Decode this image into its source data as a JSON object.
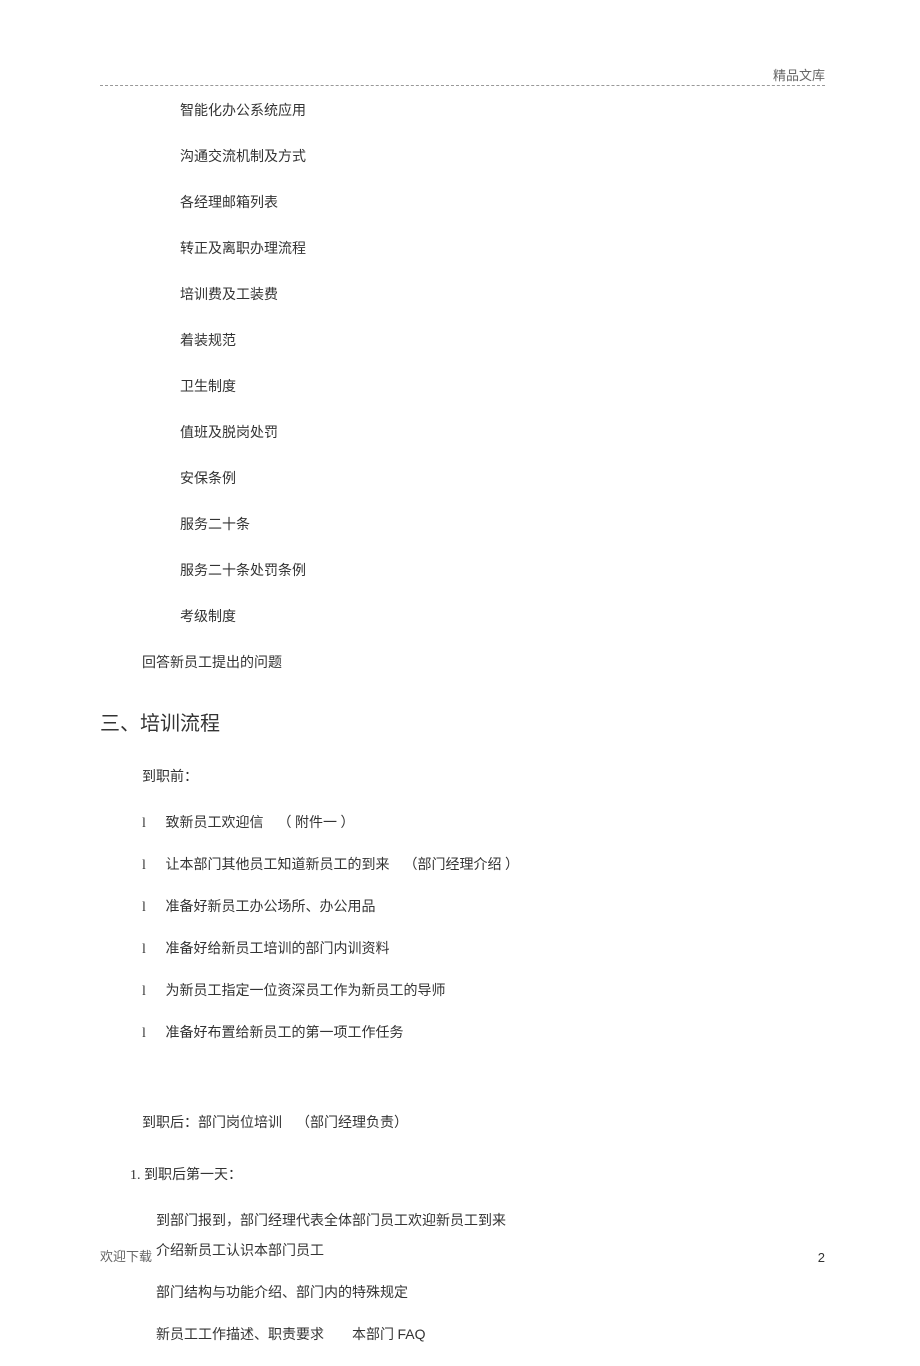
{
  "header": {
    "label": "精品文库"
  },
  "body": {
    "items": [
      "智能化办公系统应用",
      "沟通交流机制及方式",
      "各经理邮箱列表",
      "转正及离职办理流程",
      "培训费及工装费",
      "着装规范",
      "卫生制度",
      "值班及脱岗处罚",
      "安保条例",
      "服务二十条",
      "服务二十条处罚条例",
      "考级制度"
    ],
    "answer_line": "回答新员工提出的问题",
    "section3": {
      "heading": "三、培训流程",
      "before": {
        "label": "到职前：",
        "bullets": [
          {
            "text": "致新员工欢迎信",
            "suffix": "（ 附件一 ）"
          },
          {
            "text": "让本部门其他员工知道新员工的到来",
            "suffix": "（部门经理介绍 ）"
          },
          {
            "text": "准备好新员工办公场所、办公用品",
            "suffix": ""
          },
          {
            "text": "准备好给新员工培训的部门内训资料",
            "suffix": ""
          },
          {
            "text": "为新员工指定一位资深员工作为新员工的导师",
            "suffix": ""
          },
          {
            "text": "准备好布置给新员工的第一项工作任务",
            "suffix": ""
          }
        ]
      },
      "after": {
        "label_prefix": "到职后：部门岗位培训",
        "label_suffix": "（部门经理负责）",
        "day1": {
          "label": "1. 到职后第一天：",
          "line1": "到部门报到，部门经理代表全体部门员工欢迎新员工到来",
          "line2": "介绍新员工认识本部门员工",
          "line3": "部门结构与功能介绍、部门内的特殊规定",
          "line4_a": "新员工工作描述、职责要求",
          "line4_b": "本部门",
          "line4_c": "FAQ"
        }
      }
    }
  },
  "footer": {
    "left": "欢迎下载",
    "page": "2"
  }
}
